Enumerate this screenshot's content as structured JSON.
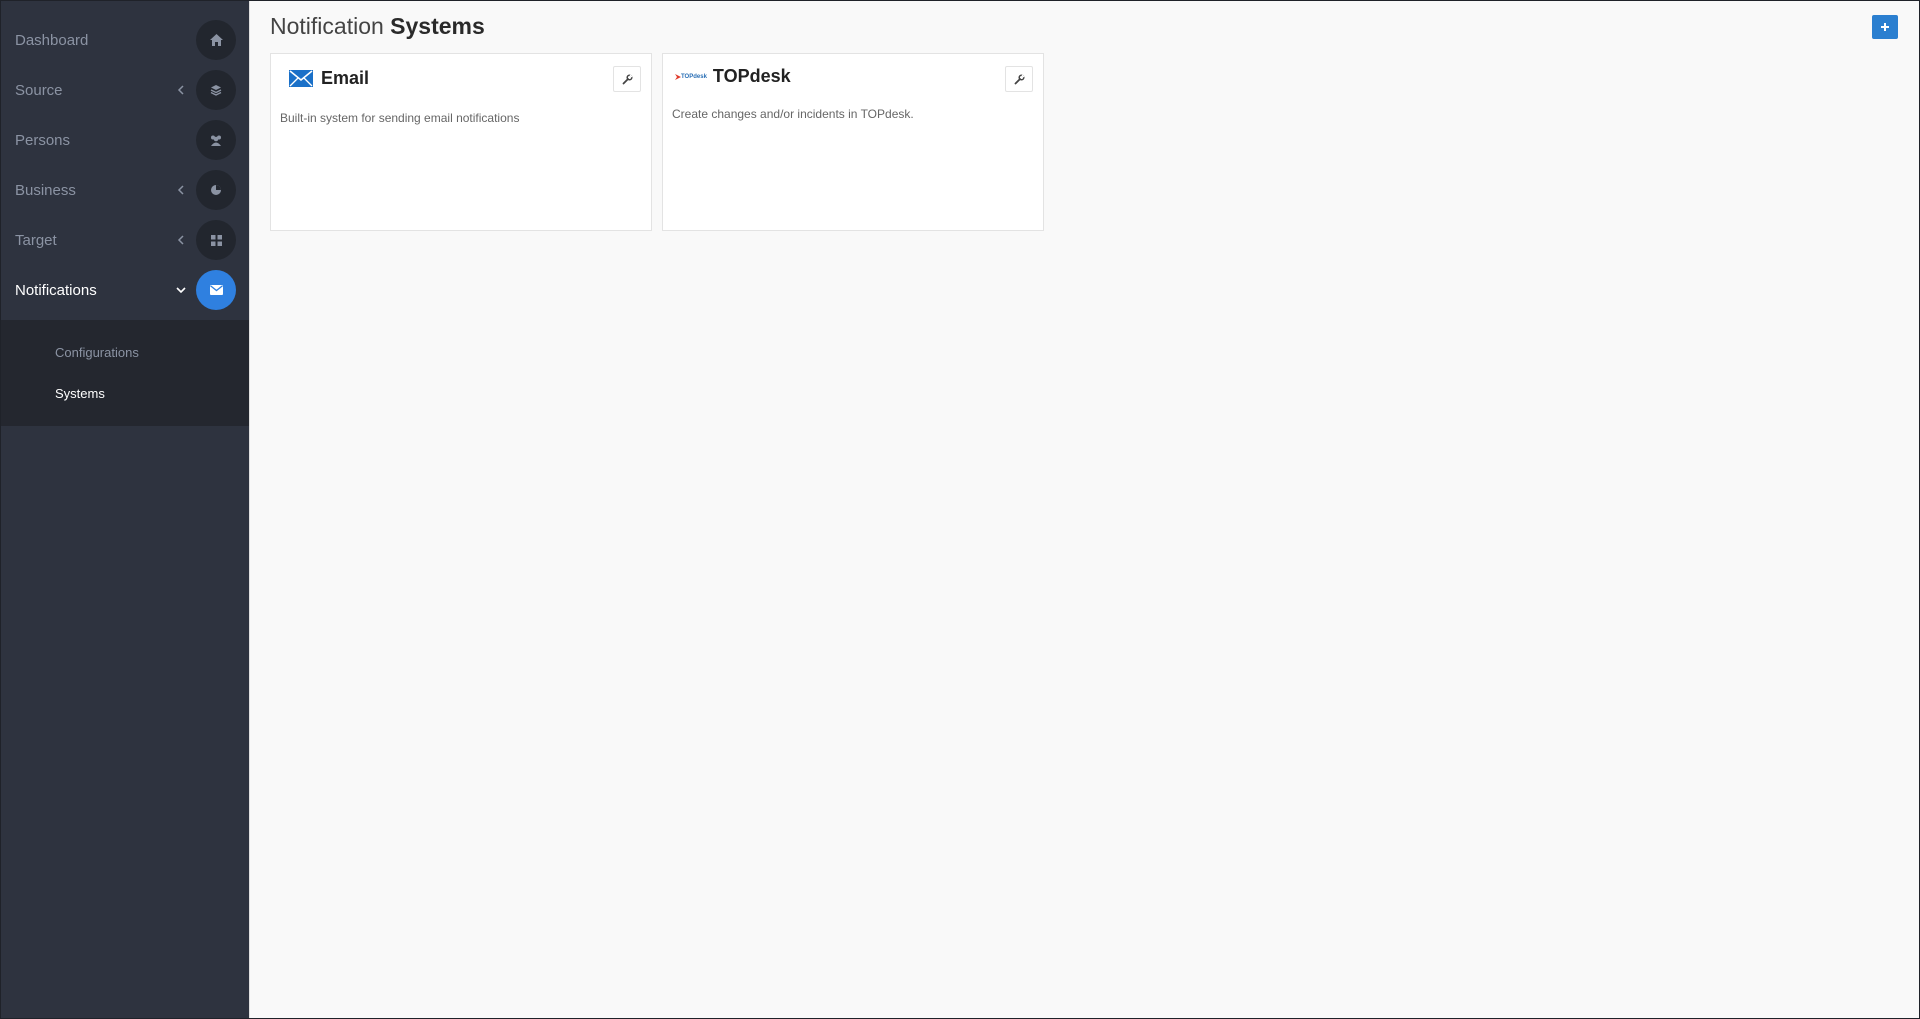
{
  "sidebar": {
    "items": [
      {
        "label": "Dashboard",
        "icon": "home-icon"
      },
      {
        "label": "Source",
        "icon": "layers-icon"
      },
      {
        "label": "Persons",
        "icon": "users-icon"
      },
      {
        "label": "Business",
        "icon": "pie-chart-icon"
      },
      {
        "label": "Target",
        "icon": "grid-icon"
      },
      {
        "label": "Notifications",
        "icon": "envelope-icon"
      }
    ],
    "submenu": [
      {
        "label": "Configurations"
      },
      {
        "label": "Systems"
      }
    ]
  },
  "page": {
    "title_light": "Notification",
    "title_bold": "Systems"
  },
  "cards": [
    {
      "title": "Email",
      "description": "Built-in system for sending email notifications",
      "icon": "envelope-icon"
    },
    {
      "title": "TOPdesk",
      "description": "Create changes and/or incidents in TOPdesk.",
      "logo_text": "TOPdesk",
      "icon": "topdesk-logo-icon"
    }
  ],
  "colors": {
    "sidebar_bg": "#2e333f",
    "accent": "#2f80e0",
    "add_button": "#2b7fd0"
  }
}
